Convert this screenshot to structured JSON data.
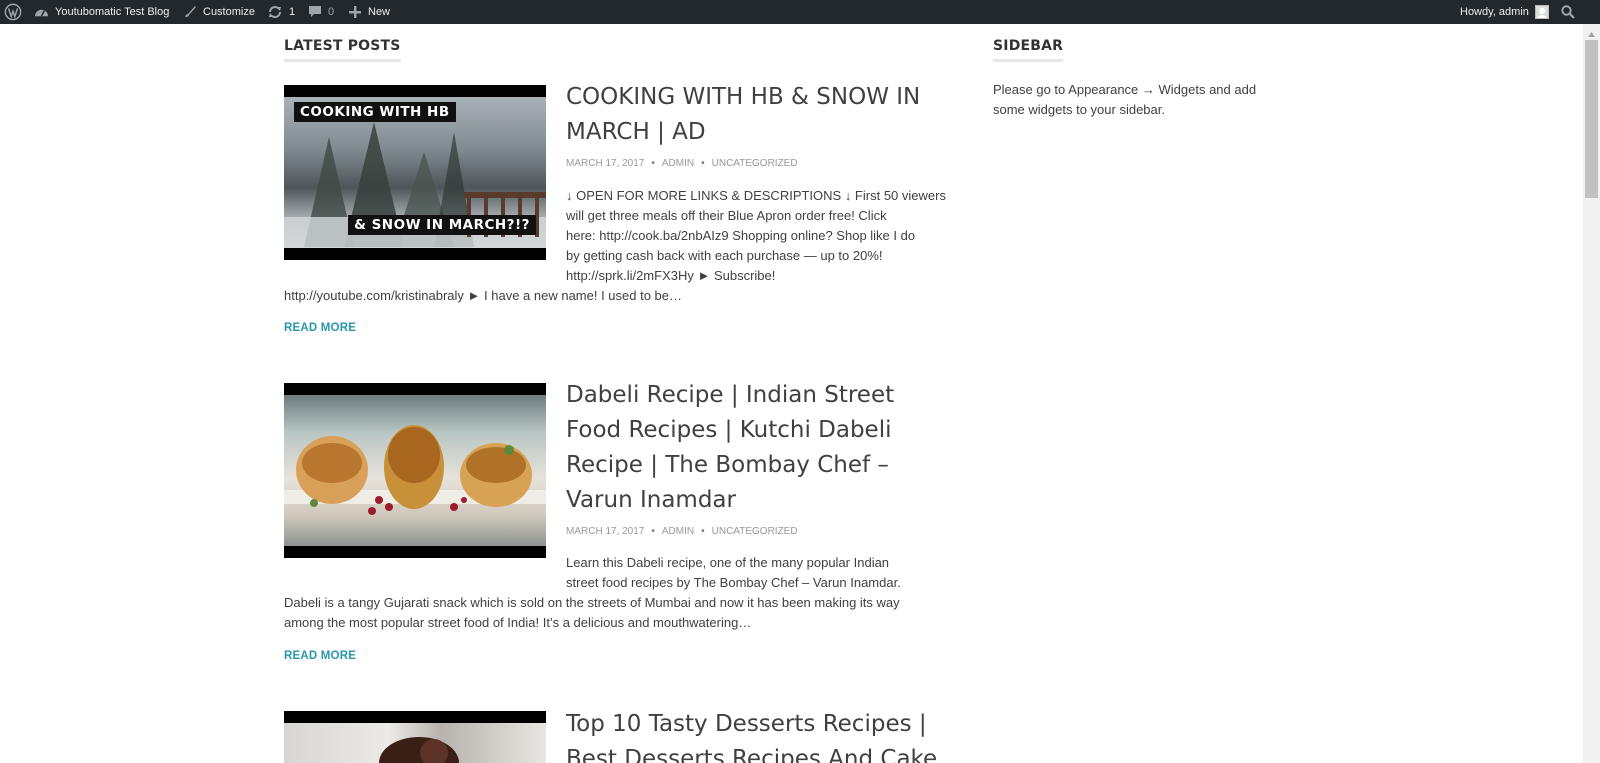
{
  "admin_bar": {
    "site_name": "Youtubomatic Test Blog",
    "customize": "Customize",
    "updates_count": "1",
    "comments_count": "0",
    "new_label": "New",
    "howdy": "Howdy, admin",
    "icons": [
      "wordpress-logo-icon",
      "dashboard-icon",
      "brush-icon",
      "updates-icon",
      "comments-icon",
      "plus-icon",
      "search-icon"
    ]
  },
  "main": {
    "section_title": "LATEST POSTS",
    "posts": [
      {
        "title_line1": "COOKING WITH HB & SNOW IN",
        "title_line2": "MARCH | AD",
        "thumb_caption1": "COOKING WITH HB",
        "thumb_caption2": "& SNOW IN MARCH?!?",
        "date": "MARCH 17, 2017",
        "author": "ADMIN",
        "category": "UNCATEGORIZED",
        "excerpt_lines": [
          "↓ OPEN FOR MORE LINKS & DESCRIPTIONS ↓ First 50 viewers",
          "will get three meals off their Blue Apron order free! Click",
          "here: http://cook.ba/2nbAIz9 Shopping online? Shop like I do",
          "by getting cash back with each purchase — up to 20%!",
          "http://sprk.li/2mFX3Hy ► Subscribe!"
        ],
        "excerpt_wide": "http://youtube.com/kristinabraly ► I have a new name! I used to be…",
        "read_more": "READ MORE"
      },
      {
        "title_lines": [
          "Dabeli Recipe | Indian Street",
          "Food Recipes | Kutchi Dabeli",
          "Recipe | The Bombay Chef –",
          "Varun Inamdar"
        ],
        "date": "MARCH 17, 2017",
        "author": "ADMIN",
        "category": "UNCATEGORIZED",
        "excerpt_lines": [
          "Learn this Dabeli recipe, one of the many popular Indian",
          "street food recipes by The Bombay Chef – Varun Inamdar."
        ],
        "excerpt_wide_lines": [
          "Dabeli is a tangy Gujarati snack which is sold on the streets of Mumbai and now it has been making its way",
          "among the most popular street food of India! It’s a delicious and mouthwatering…"
        ],
        "read_more": "READ MORE"
      },
      {
        "title_lines": [
          "Top 10 Tasty Desserts Recipes |",
          "Best Desserts Recipes And Cake"
        ]
      }
    ]
  },
  "sidebar": {
    "title": "SIDEBAR",
    "text_line1": "Please go to Appearance → Widgets and add",
    "text_line2": "some widgets to your sidebar."
  },
  "colors": {
    "admin_bar_bg": "#23282d",
    "link_accent": "#2997ab",
    "text": "#404040",
    "meta": "#999999"
  }
}
